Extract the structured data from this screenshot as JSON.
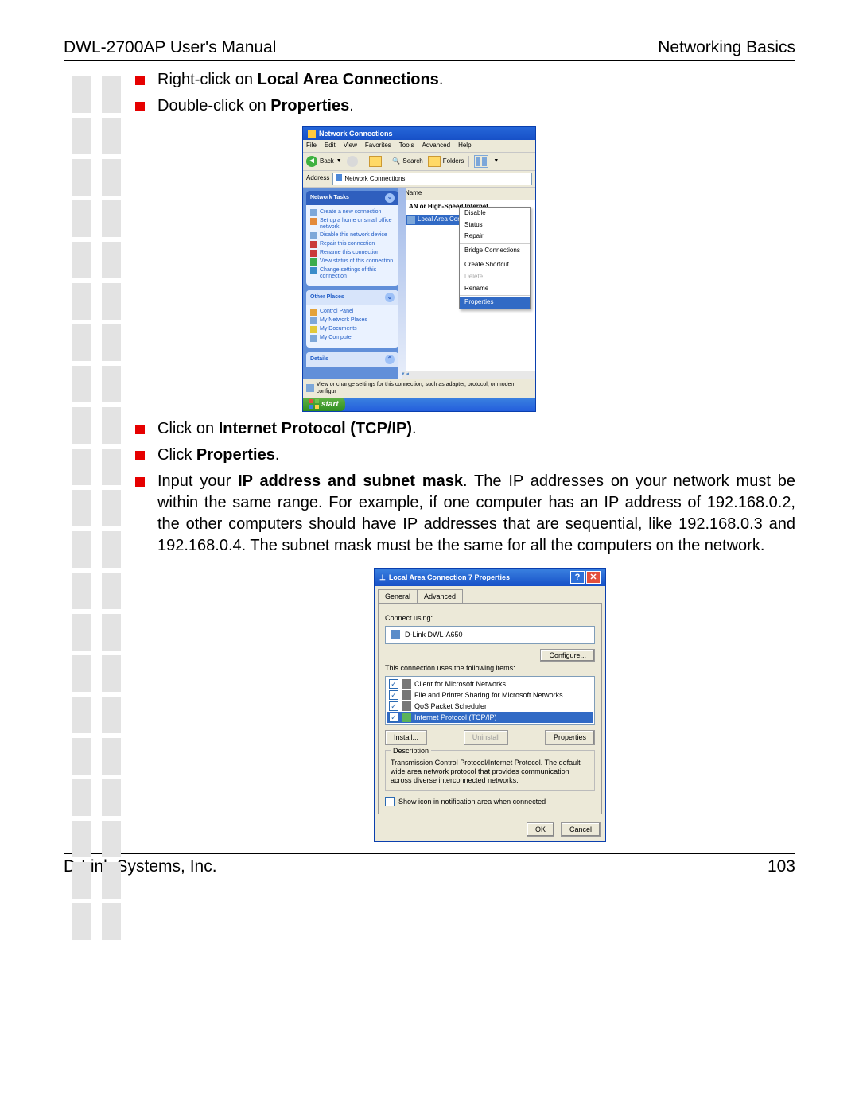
{
  "header": {
    "left": "DWL-2700AP User's Manual",
    "right": "Networking Basics"
  },
  "footer": {
    "left": "D-Link Systems, Inc.",
    "right": "103"
  },
  "bullet1_pre": "Right-click on ",
  "bullet1_b": "Local Area Connections",
  "bullet1_post": ".",
  "bullet2_pre": "Double-click on ",
  "bullet2_b": "Properties",
  "bullet2_post": ".",
  "bullet3_pre": "Click on ",
  "bullet3_b": "Internet Protocol (TCP/IP)",
  "bullet3_post": ".",
  "bullet4_pre": "Click ",
  "bullet4_b": "Properties",
  "bullet4_post": ".",
  "bullet5_pre": "Input your ",
  "bullet5_b": "IP address and subnet mask",
  "bullet5_post": ". The IP addresses on your network must be within the same range. For example, if one computer has an IP address of 192.168.0.2, the other computers should have IP addresses that are sequential, like 192.168.0.3 and 192.168.0.4. The subnet mask must be the same for all the computers on the network.",
  "shot1": {
    "title": "Network Connections",
    "menu": [
      "File",
      "Edit",
      "View",
      "Favorites",
      "Tools",
      "Advanced",
      "Help"
    ],
    "tb": {
      "back": "Back",
      "search": "Search",
      "folders": "Folders"
    },
    "addr_lbl": "Address",
    "addr_val": "Network Connections",
    "tasks_hd": "Network Tasks",
    "tasks": [
      "Create a new connection",
      "Set up a home or small office network",
      "Disable this network device",
      "Repair this connection",
      "Rename this connection",
      "View status of this connection",
      "Change settings of this connection"
    ],
    "other_hd": "Other Places",
    "other": [
      "Control Panel",
      "My Network Places",
      "My Documents",
      "My Computer"
    ],
    "details_hd": "Details",
    "col_name": "Name",
    "group_lbl": "LAN or High-Speed Internet",
    "item": "Local Area Con",
    "ctx": {
      "disable": "Disable",
      "status": "Status",
      "repair": "Repair",
      "bridge": "Bridge Connections",
      "shortcut": "Create Shortcut",
      "delete": "Delete",
      "rename": "Rename",
      "properties": "Properties"
    },
    "status_text": "View or change settings for this connection, such as adapter, protocol, or modem configur",
    "start": "start"
  },
  "shot2": {
    "title": "Local Area Connection 7 Properties",
    "tabs": {
      "general": "General",
      "advanced": "Advanced"
    },
    "connect_using": "Connect using:",
    "adapter": "D-Link DWL-A650",
    "configure": "Configure...",
    "uses": "This connection uses the following items:",
    "items": [
      "Client for Microsoft Networks",
      "File and Printer Sharing for Microsoft Networks",
      "QoS Packet Scheduler",
      "Internet Protocol (TCP/IP)"
    ],
    "install": "Install...",
    "uninstall": "Uninstall",
    "properties": "Properties",
    "desc_hd": "Description",
    "desc": "Transmission Control Protocol/Internet Protocol. The default wide area network protocol that provides communication across diverse interconnected networks.",
    "show_icon": "Show icon in notification area when connected",
    "ok": "OK",
    "cancel": "Cancel"
  }
}
